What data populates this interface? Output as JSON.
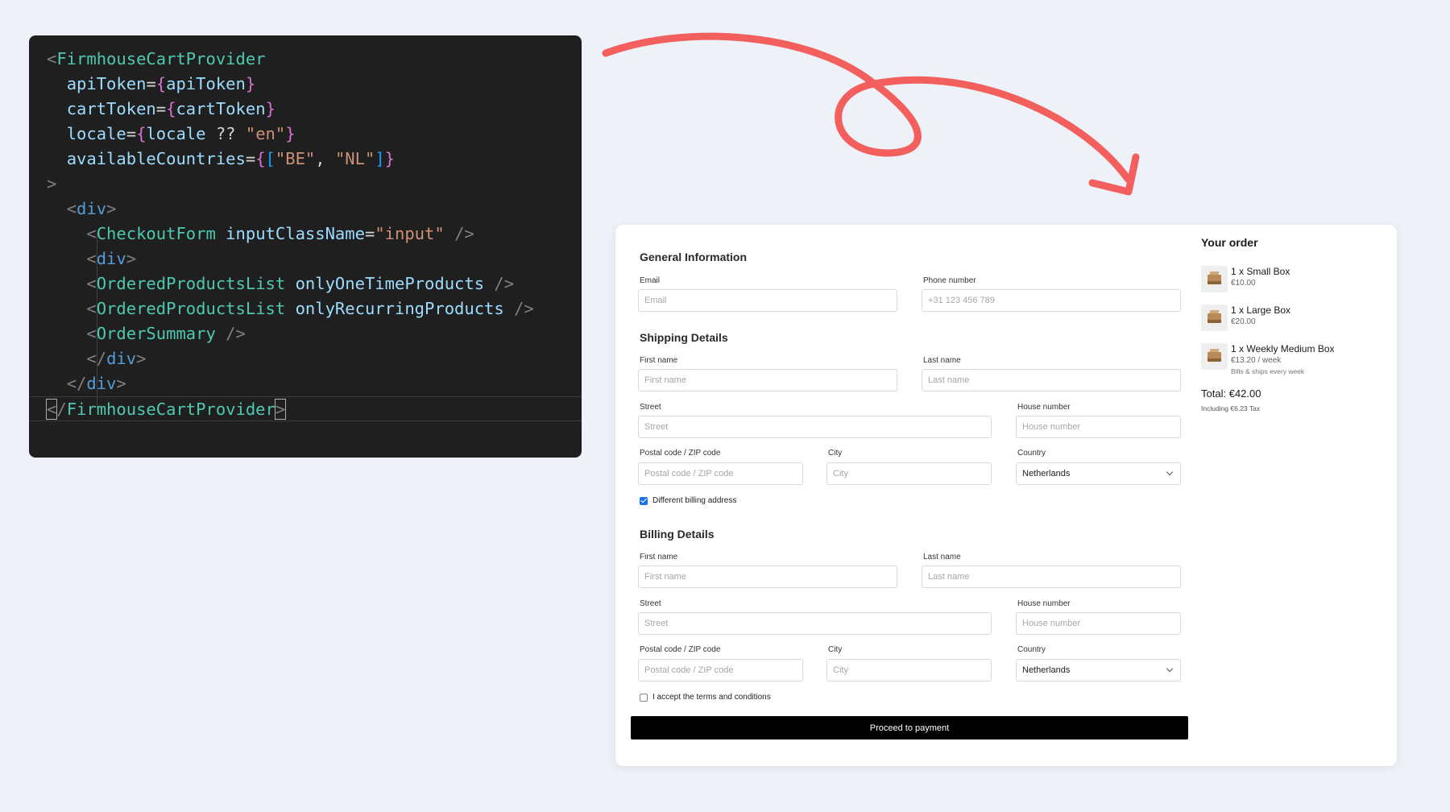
{
  "code": {
    "lines": [
      [
        [
          "t-punc",
          "<"
        ],
        [
          "t-comp",
          "FirmhouseCartProvider"
        ]
      ],
      [
        [
          "t-op",
          "  "
        ],
        [
          "t-attr",
          "apiToken"
        ],
        [
          "t-op",
          "="
        ],
        [
          "t-brace1",
          "{"
        ],
        [
          "t-attr",
          "apiToken"
        ],
        [
          "t-brace1",
          "}"
        ]
      ],
      [
        [
          "t-op",
          "  "
        ],
        [
          "t-attr",
          "cartToken"
        ],
        [
          "t-op",
          "="
        ],
        [
          "t-brace1",
          "{"
        ],
        [
          "t-attr",
          "cartToken"
        ],
        [
          "t-brace1",
          "}"
        ]
      ],
      [
        [
          "t-op",
          "  "
        ],
        [
          "t-attr",
          "locale"
        ],
        [
          "t-op",
          "="
        ],
        [
          "t-brace1",
          "{"
        ],
        [
          "t-attr",
          "locale"
        ],
        [
          "t-op",
          " ?? "
        ],
        [
          "t-str",
          "\"en\""
        ],
        [
          "t-brace1",
          "}"
        ]
      ],
      [
        [
          "t-op",
          "  "
        ],
        [
          "t-attr",
          "availableCountries"
        ],
        [
          "t-op",
          "="
        ],
        [
          "t-brace1",
          "{"
        ],
        [
          "t-brace2",
          "["
        ],
        [
          "t-str",
          "\"BE\""
        ],
        [
          "t-op",
          ", "
        ],
        [
          "t-str",
          "\"NL\""
        ],
        [
          "t-brace2",
          "]"
        ],
        [
          "t-brace1",
          "}"
        ]
      ],
      [
        [
          "t-punc",
          ">"
        ]
      ],
      [
        [
          "t-op",
          "  "
        ],
        [
          "t-punc",
          "<"
        ],
        [
          "t-tag",
          "div"
        ],
        [
          "t-punc",
          ">"
        ]
      ],
      [
        [
          "t-op",
          "    "
        ],
        [
          "t-punc",
          "<"
        ],
        [
          "t-comp",
          "CheckoutForm"
        ],
        [
          "t-op",
          " "
        ],
        [
          "t-attr",
          "inputClassName"
        ],
        [
          "t-op",
          "="
        ],
        [
          "t-str",
          "\"input\""
        ],
        [
          "t-op",
          " "
        ],
        [
          "t-punc",
          "/>"
        ]
      ],
      [
        [
          "t-op",
          "    "
        ],
        [
          "t-punc",
          "<"
        ],
        [
          "t-tag",
          "div"
        ],
        [
          "t-punc",
          ">"
        ]
      ],
      [
        [
          "t-op",
          "    "
        ],
        [
          "t-punc",
          "<"
        ],
        [
          "t-comp",
          "OrderedProductsList"
        ],
        [
          "t-op",
          " "
        ],
        [
          "t-attr",
          "onlyOneTimeProducts"
        ],
        [
          "t-op",
          " "
        ],
        [
          "t-punc",
          "/>"
        ]
      ],
      [
        [
          "t-op",
          "    "
        ],
        [
          "t-punc",
          "<"
        ],
        [
          "t-comp",
          "OrderedProductsList"
        ],
        [
          "t-op",
          " "
        ],
        [
          "t-attr",
          "onlyRecurringProducts"
        ],
        [
          "t-op",
          " "
        ],
        [
          "t-punc",
          "/>"
        ]
      ],
      [
        [
          "t-op",
          "    "
        ],
        [
          "t-punc",
          "<"
        ],
        [
          "t-comp",
          "OrderSummary"
        ],
        [
          "t-op",
          " "
        ],
        [
          "t-punc",
          "/>"
        ]
      ],
      [
        [
          "t-op",
          "    "
        ],
        [
          "t-punc",
          "</"
        ],
        [
          "t-tag",
          "div"
        ],
        [
          "t-punc",
          ">"
        ]
      ],
      [
        [
          "t-op",
          "  "
        ],
        [
          "t-punc",
          "</"
        ],
        [
          "t-tag",
          "div"
        ],
        [
          "t-punc",
          ">"
        ]
      ],
      [
        [
          "t-punc cursor-box",
          "<"
        ],
        [
          "t-punc",
          "/"
        ],
        [
          "t-comp",
          "FirmhouseCartProvider"
        ],
        [
          "t-punc cursor-box",
          ">"
        ]
      ]
    ]
  },
  "general": {
    "title": "General Information",
    "email_label": "Email",
    "email_placeholder": "Email",
    "phone_label": "Phone number",
    "phone_placeholder": "+31 123 456 789"
  },
  "shipping": {
    "title": "Shipping Details",
    "first_name_label": "First name",
    "first_name_placeholder": "First name",
    "last_name_label": "Last name",
    "last_name_placeholder": "Last name",
    "street_label": "Street",
    "street_placeholder": "Street",
    "house_label": "House number",
    "house_placeholder": "House number",
    "postal_label": "Postal code / ZIP code",
    "postal_placeholder": "Postal code / ZIP code",
    "city_label": "City",
    "city_placeholder": "City",
    "country_label": "Country",
    "country_value": "Netherlands",
    "different_billing_label": "Different billing address"
  },
  "billing": {
    "title": "Billing Details",
    "first_name_label": "First name",
    "first_name_placeholder": "First name",
    "last_name_label": "Last name",
    "last_name_placeholder": "Last name",
    "street_label": "Street",
    "street_placeholder": "Street",
    "house_label": "House number",
    "house_placeholder": "House number",
    "postal_label": "Postal code / ZIP code",
    "postal_placeholder": "Postal code / ZIP code",
    "city_label": "City",
    "city_placeholder": "City",
    "country_label": "Country",
    "country_value": "Netherlands",
    "terms_label": "I accept the terms and conditions"
  },
  "pay_button_label": "Proceed to payment",
  "order": {
    "title": "Your order",
    "items": [
      {
        "name": "1 x Small Box",
        "price": "€10.00",
        "note": ""
      },
      {
        "name": "1 x Large Box",
        "price": "€20.00",
        "note": ""
      },
      {
        "name": "1 x Weekly Medium Box",
        "price": "€13.20 / week",
        "note": "Bills & ships every week"
      }
    ],
    "total_label": "Total:",
    "total_value": "€42.00",
    "tax_note": "Including €6.23 Tax"
  },
  "colors": {
    "arrow": "#f25f5c",
    "button": "#000000",
    "checkbox_checked": "#1a73e8"
  }
}
